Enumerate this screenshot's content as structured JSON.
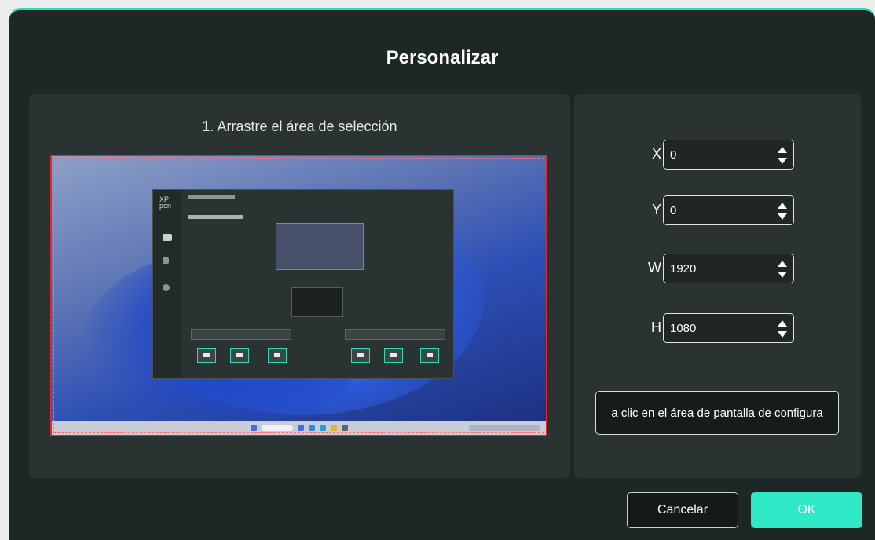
{
  "dialog": {
    "title": "Personalizar",
    "accent_color": "#2fd8b8",
    "ok_color": "#2fe8c6",
    "selection_border_color": "#e8232b"
  },
  "left_panel": {
    "instruction": "1. Arrastre el área de selección"
  },
  "right_panel": {
    "fields": [
      {
        "label": "X",
        "value": "0"
      },
      {
        "label": "Y",
        "value": "0"
      },
      {
        "label": "W",
        "value": "1920"
      },
      {
        "label": "H",
        "value": "1080"
      }
    ],
    "display_area_button": "a clic en el área de pantalla de configura"
  },
  "footer": {
    "cancel_label": "Cancelar",
    "ok_label": "OK"
  },
  "icons": {
    "spinner": "up-down-arrows-icon"
  }
}
